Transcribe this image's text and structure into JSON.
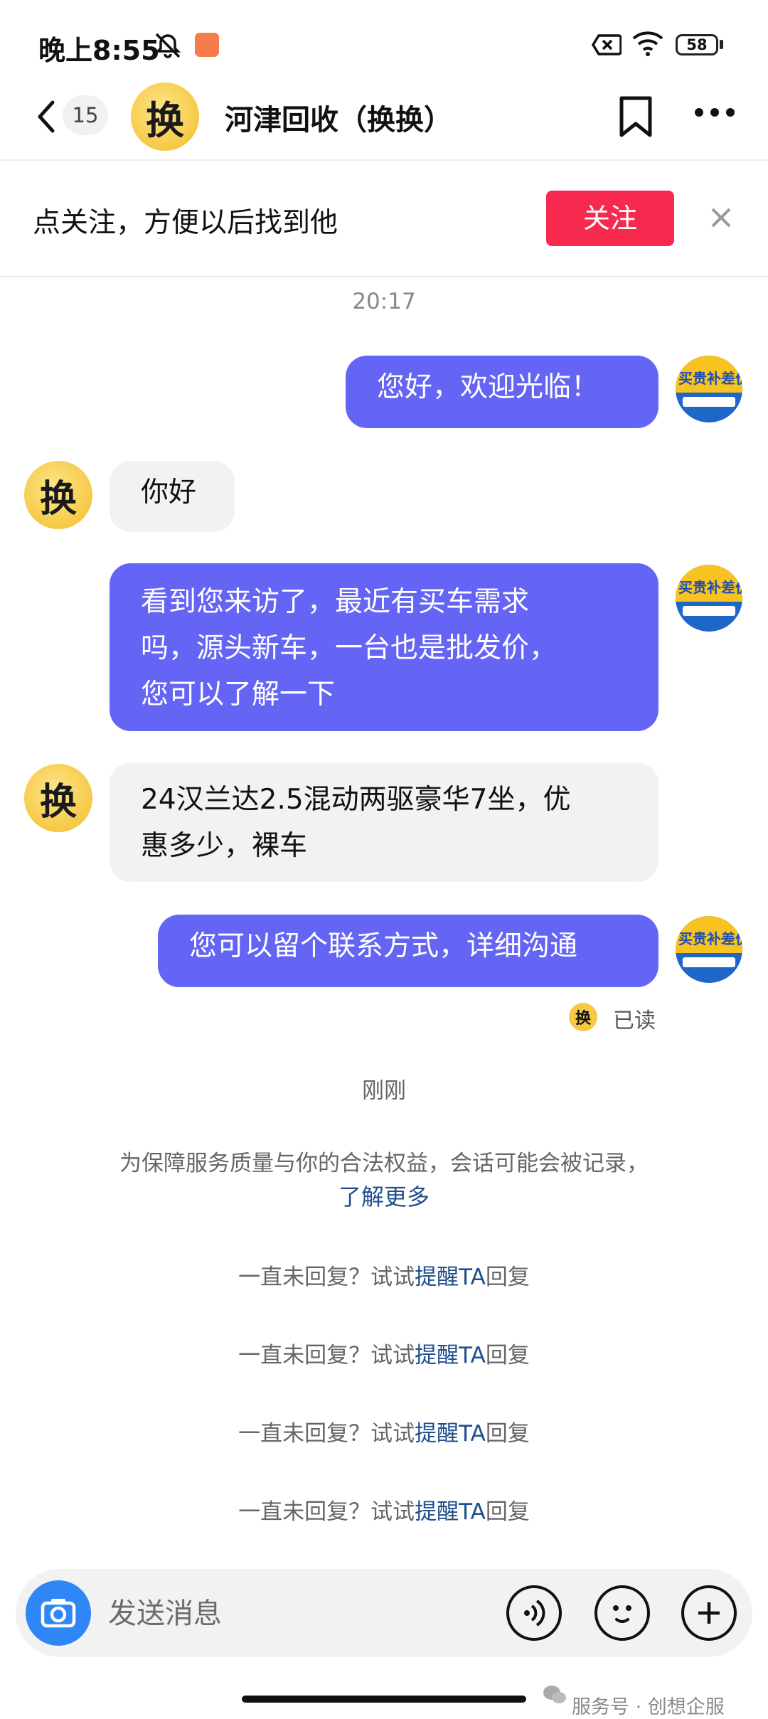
{
  "status_bar": {
    "time": "晚上8:55",
    "battery": "58"
  },
  "header": {
    "back_count": "15",
    "title": "河津回收（换换）",
    "avatar_char": "换"
  },
  "follow_bar": {
    "tip": "点关注，方便以后找到他",
    "button": "关注"
  },
  "chat": {
    "timestamp": "20:17",
    "my_avatar_text": "买贵补差价",
    "messages": [
      {
        "from": "me",
        "text": "您好，欢迎光临！"
      },
      {
        "from": "other",
        "text": "你好"
      },
      {
        "from": "me",
        "lines": [
          "看到您来访了，最近有买车需求",
          "吗，源头新车，一台也是批发价，",
          "您可以了解一下"
        ]
      },
      {
        "from": "other",
        "lines": [
          "24汉兰达2.5混动两驱豪华7坐，优",
          "惠多少，裸车"
        ]
      },
      {
        "from": "me",
        "text": "您可以留个联系方式，详细沟通"
      }
    ],
    "read_status": "已读",
    "recent_label": "刚刚",
    "notice": "为保障服务质量与你的合法权益，会话可能会被记录，",
    "notice_link": "了解更多",
    "reminder": {
      "prefix": "一直未回复？试试",
      "link": "提醒TA",
      "suffix": "回复"
    }
  },
  "input_bar": {
    "placeholder": "发送消息"
  },
  "watermark": "服务号 · 创想企服"
}
